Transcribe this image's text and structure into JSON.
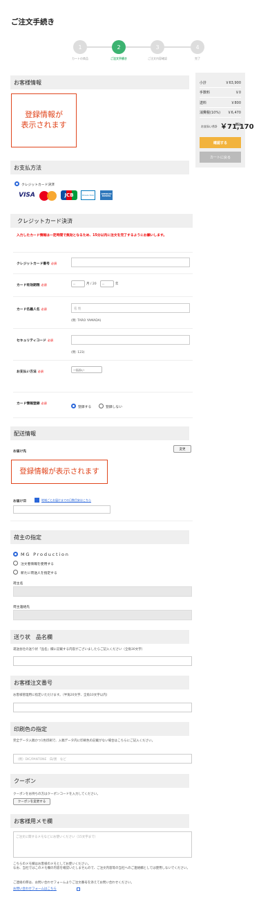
{
  "page": {
    "title": "ご注文手続き"
  },
  "steps": [
    {
      "num": "1",
      "label": "カートの商品"
    },
    {
      "num": "2",
      "label": "ご注文手続き"
    },
    {
      "num": "3",
      "label": "ご注文内容確認"
    },
    {
      "num": "4",
      "label": "完了"
    }
  ],
  "customer": {
    "heading": "お客様情報",
    "placeholder": "登録情報が\n表示されます"
  },
  "summary": {
    "subtotal_label": "小計",
    "subtotal": "￥63,900",
    "fee_label": "手数料",
    "fee": "￥0",
    "shipping_label": "送料",
    "shipping": "￥800",
    "tax_label": "消費税(10%)",
    "tax": "￥6,470",
    "total_label": "お支払い合計",
    "total": "￥71,170",
    "total_suffix": "税込",
    "confirm_button": "確認する",
    "back_button": "カートに戻る"
  },
  "payment": {
    "heading": "お支払方法",
    "method_label": "クレジットカード決済",
    "card_logos": [
      "VISA",
      "Mastercard",
      "JCB",
      "Diners Club",
      "AMERICAN EXPRESS"
    ]
  },
  "credit": {
    "heading": "クレジットカード決済",
    "notice": "入力したカード情報は一定時間で無効となるため、15分以内に注文を完了するようにお願いします。",
    "required": "必須",
    "number_label": "クレジットカード番号",
    "expiry_label": "カード有効期限",
    "expiry_month": "--",
    "expiry_month_unit": "月 / 20",
    "expiry_year": "--",
    "expiry_year_unit": "年",
    "name_label": "カード名義人名",
    "name_placeholder": "名 姓",
    "name_example": "(例: TARO YAMADA)",
    "security_label": "セキュリティコード",
    "security_example": "(例: 123)",
    "installment_label": "お支払い方法",
    "installment_value": "一括払い",
    "register_label": "カード情報登録",
    "register_yes": "登録する",
    "register_no": "登録しない"
  },
  "delivery": {
    "heading": "配送情報",
    "dest_label": "お届け先",
    "change_button": "変更",
    "placeholder": "登録情報が表示されます",
    "date_label": "お届け日",
    "date_link": "地域ごとお届けまでの日数目安はこちら"
  },
  "shipper": {
    "heading": "荷主の指定",
    "option1": "MG Production",
    "option2": "注文者情報を使用する",
    "option3": "新たに荷送人を指定する",
    "name_label": "荷主名",
    "contact_label": "荷主連絡先"
  },
  "slip": {
    "heading": "送り状　品名欄",
    "desc": "運送会社の送り状「品名」欄に記載する内容がございましたらご記入ください（全角30文字）"
  },
  "order_number": {
    "heading": "お客様注文番号",
    "desc": "お客様管理用に指定いただけます。（半角20文字、全角10文字以内）"
  },
  "print_color": {
    "heading": "印刷色の指定",
    "desc": "完全データ入稿かつ1色印刷で、入稿データ内に印刷色の記載がない場合はこちらにご記入ください。",
    "placeholder": "（例）DIC/PANTONE　白/黒　など"
  },
  "coupon": {
    "heading": "クーポン",
    "desc": "クーポンをお持ちの方はクーポンコードを入力してください。",
    "button": "クーポンを変更する"
  },
  "memo": {
    "heading": "お客様用メモ欄",
    "placeholder": "ご注文に関するメモなどにお使いください（15文字まで）",
    "note1": "こちらのメモ欄はお客様のメモとしてお使いください。",
    "note2": "なお、当社ではこのメモ欄の内容を確認いたしませんので、ご注文内容等の当社へのご連絡欄としては使用しないでください。",
    "note3": "ご連絡の際は、お問い合わせフォームよりご注文番号を添えてお問い合わせください。",
    "contact_link": "お問い合わせフォームはこちら"
  },
  "colors": {
    "accent": "#3cb371",
    "warning": "#e0441b",
    "confirm": "#f2b33d",
    "link": "#2a66d9"
  }
}
